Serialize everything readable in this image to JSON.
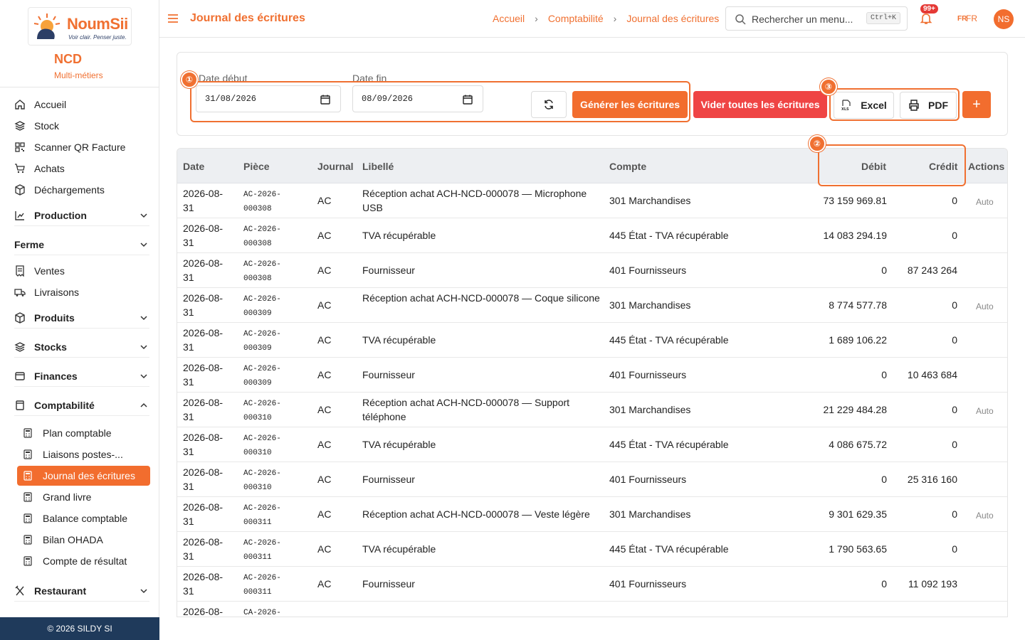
{
  "brand": {
    "logo_text": "NoumSii",
    "logo_tagline": "Voir clair. Penser juste.",
    "org_name": "NCD",
    "org_sub": "Multi-métiers"
  },
  "sidebar": {
    "items_top": [
      "Accueil",
      "Stock",
      "Scanner QR Facture",
      "Achats",
      "Déchargements"
    ],
    "group_production": "Production",
    "group_ferme": "Ferme",
    "items_mid": [
      "Ventes",
      "Livraisons"
    ],
    "group_produits": "Produits",
    "group_stocks": "Stocks",
    "group_finances": "Finances",
    "group_compta": "Comptabilité",
    "compta_items": [
      "Plan comptable",
      "Liaisons postes-...",
      "Journal des écritures",
      "Grand livre",
      "Balance comptable",
      "Bilan OHADA",
      "Compte de résultat"
    ],
    "group_restaurant": "Restaurant",
    "footer": "© 2026 SILDY SI"
  },
  "header": {
    "title": "Journal des écritures",
    "breadcrumb": [
      "Accueil",
      "Comptabilité",
      "Journal des écritures"
    ],
    "search_placeholder": "Rechercher un menu...",
    "search_shortcut": "Ctrl+K",
    "notif_badge": "99+",
    "lang_a": "FR",
    "lang_b": "FR",
    "avatar_initials": "NS"
  },
  "filters": {
    "date_debut_label": "Date début",
    "date_debut_value": "31/08/2026",
    "date_fin_label": "Date fin",
    "date_fin_value": "08/09/2026",
    "generate_label": "Générer les écritures",
    "clear_label": "Vider toutes les écritures",
    "excel_label": "Excel",
    "pdf_label": "PDF",
    "add_label": "+",
    "markers": [
      "①",
      "②",
      "③"
    ]
  },
  "table": {
    "headers": [
      "Date",
      "Pièce",
      "Journal",
      "Libellé",
      "Compte",
      "Débit",
      "Crédit",
      "Actions"
    ],
    "rows": [
      {
        "date": "2026-08-31",
        "piece": "AC-2026-000308",
        "journal": "AC",
        "libelle": "Réception achat ACH-NCD-000078 — Microphone USB",
        "compte": "301 Marchandises",
        "debit": "73 159 969.81",
        "credit": "0",
        "action": "Auto"
      },
      {
        "date": "2026-08-31",
        "piece": "AC-2026-000308",
        "journal": "AC",
        "libelle": "TVA récupérable",
        "compte": "445 État - TVA récupérable",
        "debit": "14 083 294.19",
        "credit": "0",
        "action": ""
      },
      {
        "date": "2026-08-31",
        "piece": "AC-2026-000308",
        "journal": "AC",
        "libelle": "Fournisseur",
        "compte": "401 Fournisseurs",
        "debit": "0",
        "credit": "87 243 264",
        "action": ""
      },
      {
        "date": "2026-08-31",
        "piece": "AC-2026-000309",
        "journal": "AC",
        "libelle": "Réception achat ACH-NCD-000078 — Coque silicone",
        "compte": "301 Marchandises",
        "debit": "8 774 577.78",
        "credit": "0",
        "action": "Auto"
      },
      {
        "date": "2026-08-31",
        "piece": "AC-2026-000309",
        "journal": "AC",
        "libelle": "TVA récupérable",
        "compte": "445 État - TVA récupérable",
        "debit": "1 689 106.22",
        "credit": "0",
        "action": ""
      },
      {
        "date": "2026-08-31",
        "piece": "AC-2026-000309",
        "journal": "AC",
        "libelle": "Fournisseur",
        "compte": "401 Fournisseurs",
        "debit": "0",
        "credit": "10 463 684",
        "action": ""
      },
      {
        "date": "2026-08-31",
        "piece": "AC-2026-000310",
        "journal": "AC",
        "libelle": "Réception achat ACH-NCD-000078 — Support téléphone",
        "compte": "301 Marchandises",
        "debit": "21 229 484.28",
        "credit": "0",
        "action": "Auto"
      },
      {
        "date": "2026-08-31",
        "piece": "AC-2026-000310",
        "journal": "AC",
        "libelle": "TVA récupérable",
        "compte": "445 État - TVA récupérable",
        "debit": "4 086 675.72",
        "credit": "0",
        "action": ""
      },
      {
        "date": "2026-08-31",
        "piece": "AC-2026-000310",
        "journal": "AC",
        "libelle": "Fournisseur",
        "compte": "401 Fournisseurs",
        "debit": "0",
        "credit": "25 316 160",
        "action": ""
      },
      {
        "date": "2026-08-31",
        "piece": "AC-2026-000311",
        "journal": "AC",
        "libelle": "Réception achat ACH-NCD-000078 — Veste légère",
        "compte": "301 Marchandises",
        "debit": "9 301 629.35",
        "credit": "0",
        "action": "Auto"
      },
      {
        "date": "2026-08-31",
        "piece": "AC-2026-000311",
        "journal": "AC",
        "libelle": "TVA récupérable",
        "compte": "445 État - TVA récupérable",
        "debit": "1 790 563.65",
        "credit": "0",
        "action": ""
      },
      {
        "date": "2026-08-31",
        "piece": "AC-2026-000311",
        "journal": "AC",
        "libelle": "Fournisseur",
        "compte": "401 Fournisseurs",
        "debit": "0",
        "credit": "11 092 193",
        "action": ""
      },
      {
        "date": "2026-08-",
        "piece": "CA-2026-",
        "journal": "",
        "libelle": "",
        "compte": "",
        "debit": "",
        "credit": "",
        "action": ""
      }
    ]
  },
  "colors": {
    "accent": "#f26d2e",
    "danger": "#ef4444",
    "footer": "#1f3a5b"
  }
}
